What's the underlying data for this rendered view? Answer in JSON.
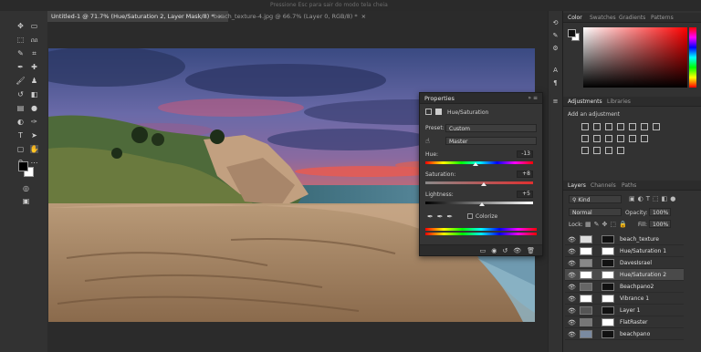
{
  "topbar": {
    "hint": "Pressione Esc para sair do modo tela cheia"
  },
  "tabs": [
    {
      "label": "Untitled-1 @ 71.7% (Hue/Saturation 2, Layer Mask/8) *",
      "close": "×"
    },
    {
      "label": "beach_texture-4.jpg @ 66.7% (Layer 0, RGB/8) *",
      "close": "×"
    }
  ],
  "right_panels": {
    "color_tabs": [
      "Color",
      "Swatches",
      "Gradients",
      "Patterns"
    ],
    "adj_tabs": [
      "Adjustments",
      "Libraries"
    ],
    "adj_hint": "Add an adjustment",
    "layers_tabs": [
      "Layers",
      "Channels",
      "Paths"
    ],
    "kind_filter": "Kind",
    "blend_mode": "Normal",
    "opacity_label": "Opacity:",
    "opacity_value": "100%",
    "lock_label": "Lock:",
    "fill_label": "Fill:",
    "fill_value": "100%"
  },
  "layers": [
    {
      "name": "beach_texture",
      "selected": false
    },
    {
      "name": "Hue/Saturation 1",
      "selected": false
    },
    {
      "name": "DavesIsrael",
      "selected": false
    },
    {
      "name": "Hue/Saturation 2",
      "selected": true
    },
    {
      "name": "Beachpano2",
      "selected": false
    },
    {
      "name": "Vibrance 1",
      "selected": false
    },
    {
      "name": "Layer 1",
      "selected": false
    },
    {
      "name": "FlatRaster",
      "selected": false
    },
    {
      "name": "beachpano",
      "selected": false
    }
  ],
  "properties": {
    "title": "Properties",
    "subtitle": "Hue/Saturation",
    "preset_label": "Preset:",
    "preset_value": "Custom",
    "channel": "Master",
    "hue_label": "Hue:",
    "hue_value": "-13",
    "saturation_label": "Saturation:",
    "saturation_value": "+8",
    "lightness_label": "Lightness:",
    "lightness_value": "+5",
    "colorize_label": "Colorize",
    "hue_level": -13,
    "saturation_level": 8,
    "lightness_level": 5
  },
  "colors": {
    "accent": "#4a4a4a",
    "panel": "#323232",
    "canvas": "#2b2b2b"
  }
}
